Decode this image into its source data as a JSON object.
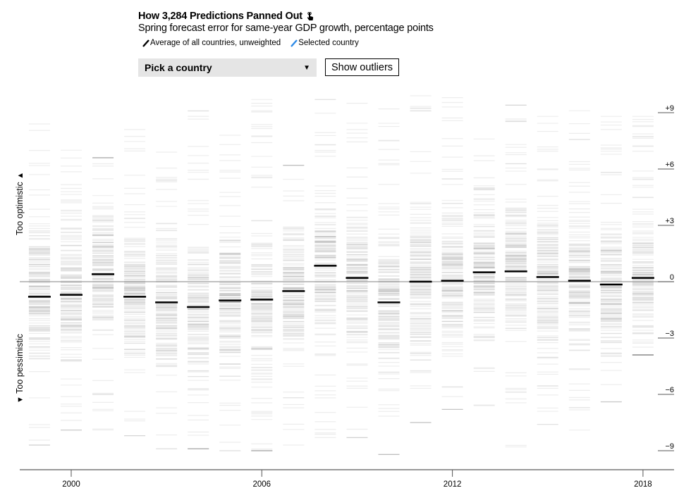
{
  "header": {
    "title": "How 3,284 Predictions Panned Out",
    "title_icon": "hand-pointer-icon",
    "subtitle": "Spring forecast error for same-year GDP growth, percentage points"
  },
  "legend": [
    {
      "label": "Average of all countries, unweighted",
      "color": "#000000"
    },
    {
      "label": "Selected country",
      "color": "#2d8ae6"
    }
  ],
  "controls": {
    "select_label": "Pick a country",
    "select_caret": "▼",
    "outliers_button": "Show outliers"
  },
  "side_labels": {
    "top": "Too optimistic",
    "top_arrow": "▲",
    "bottom": "Too pessimistic",
    "bottom_arrow": "▼"
  },
  "chart_data": {
    "type": "strip",
    "title": "How 3,284 Predictions Panned Out",
    "subtitle": "Spring forecast error for same-year GDP growth, percentage points",
    "total_predictions": 3284,
    "ylim": [
      -10,
      10
    ],
    "y_ticks": [
      9,
      6,
      3,
      0,
      -3,
      -6,
      -9
    ],
    "y_tick_labels": [
      "+9",
      "+6",
      "+3",
      "0",
      "−3",
      "−6",
      "−9"
    ],
    "x_ticks": [
      2000,
      2006,
      2012,
      2018
    ],
    "x_tick_labels": [
      "2000",
      "2006",
      "2012",
      "2018"
    ],
    "xlim": [
      1998.4,
      2018.9
    ],
    "reference_line": 0,
    "years": [
      1999,
      2000,
      2001,
      2002,
      2003,
      2004,
      2005,
      2006,
      2007,
      2008,
      2009,
      2010,
      2011,
      2012,
      2013,
      2014,
      2015,
      2016,
      2017,
      2018
    ],
    "series": [
      {
        "name": "Average of all countries, unweighted",
        "values": [
          -0.8,
          -0.7,
          0.4,
          -0.8,
          -1.1,
          -1.35,
          -1.0,
          -0.95,
          -0.5,
          0.85,
          0.2,
          -1.1,
          0.0,
          0.05,
          0.5,
          0.55,
          0.25,
          0.05,
          -0.15,
          0.2
        ]
      },
      {
        "name": "Country range max",
        "values": [
          8.4,
          7.0,
          6.6,
          8.1,
          6.9,
          9.1,
          7.8,
          9.7,
          6.2,
          9.7,
          9.5,
          9.2,
          9.9,
          9.8,
          7.6,
          9.4,
          8.8,
          9.1,
          8.8,
          8.8
        ]
      },
      {
        "name": "Country range min",
        "values": [
          -8.7,
          -7.9,
          -7.9,
          -8.2,
          -8.9,
          -8.9,
          -9.0,
          -9.0,
          -8.7,
          -8.3,
          -8.3,
          -9.2,
          -7.5,
          -6.8,
          -6.6,
          -8.8,
          -7.6,
          -7.9,
          -6.4,
          -3.9
        ]
      }
    ]
  }
}
